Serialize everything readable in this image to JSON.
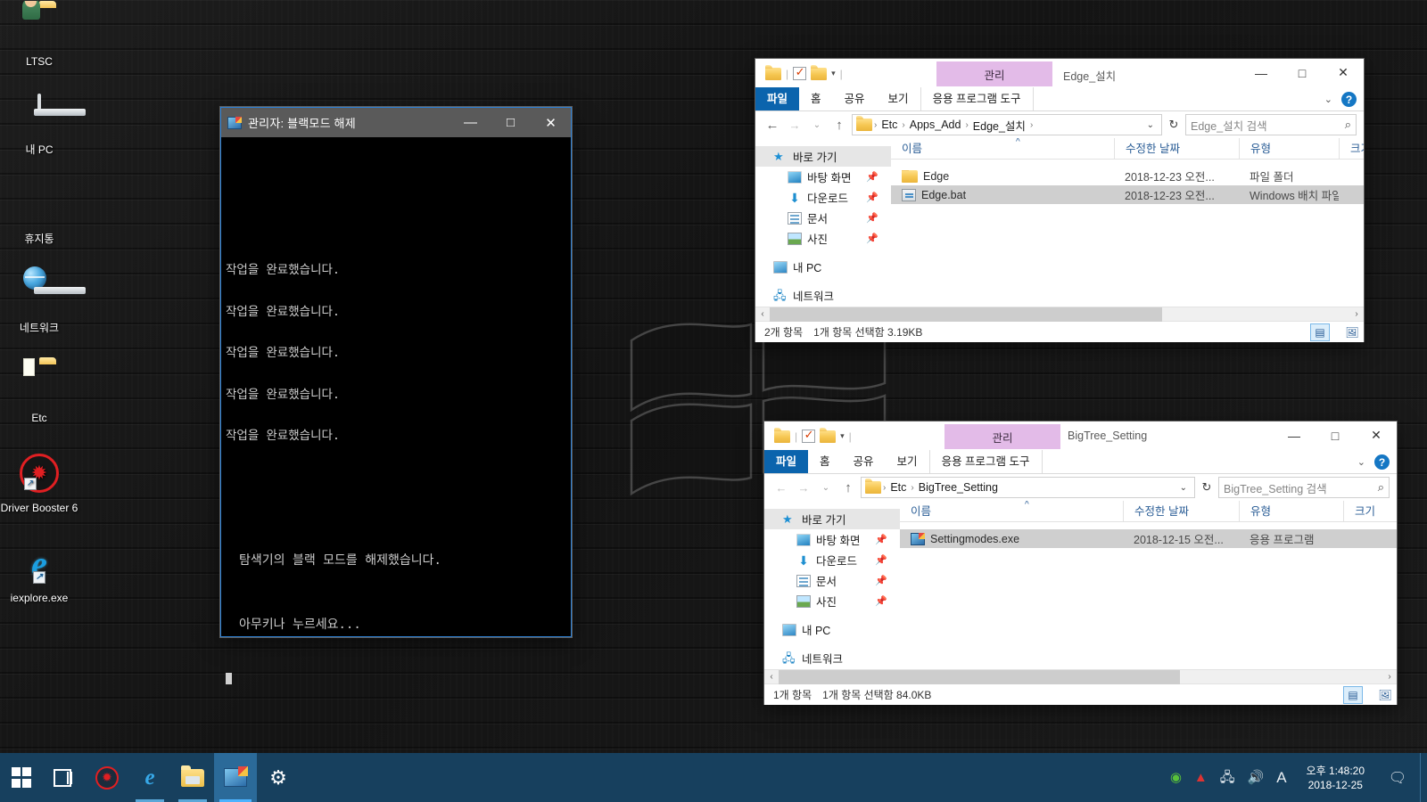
{
  "desktop": {
    "icons": [
      {
        "label": "LTSC",
        "icon": "user-folder-icon"
      },
      {
        "label": "내 PC",
        "icon": "computer-icon"
      },
      {
        "label": "휴지통",
        "icon": "recycle-bin-icon"
      },
      {
        "label": "네트워크",
        "icon": "network-icon"
      },
      {
        "label": "Etc",
        "icon": "folder-icon"
      },
      {
        "label": "Driver Booster 6",
        "icon": "driver-booster-icon"
      },
      {
        "label": "iexplore.exe",
        "icon": "internet-explorer-icon"
      }
    ]
  },
  "console": {
    "title": "관리자:  블랙모드 해제",
    "icon": "console-icon",
    "minimize": "—",
    "maximize": "□",
    "close": "✕",
    "lines": [
      "작업을 완료했습니다.",
      "작업을 완료했습니다.",
      "작업을 완료했습니다.",
      "작업을 완료했습니다.",
      "작업을 완료했습니다."
    ],
    "message": "탐색기의 블랙 모드를 해제했습니다.",
    "prompt": "아무키나 누르세요..."
  },
  "explorer1": {
    "window_title": "Edge_설치",
    "context_tab": "관리",
    "minimize": "—",
    "maximize": "□",
    "close": "✕",
    "ribbon_tabs": [
      "파일",
      "홈",
      "공유",
      "보기",
      "응용 프로그램 도구"
    ],
    "help_glyph": "?",
    "collapse_glyph": "⌄",
    "address": {
      "back": "←",
      "forward": "→",
      "recent": "⌄",
      "up": "↑",
      "crumbs": [
        "Etc",
        "Apps_Add",
        "Edge_설치"
      ],
      "trailing_arrow": "›",
      "dropdown": "⌄",
      "refresh": "↻"
    },
    "search_placeholder": "Edge_설치 검색",
    "nav": {
      "groups": [
        {
          "label": "바로 가기",
          "icon": "quick-access-star-icon",
          "selected": true,
          "children": [
            {
              "label": "바탕 화면",
              "icon": "desktop-icon",
              "pinned": true
            },
            {
              "label": "다운로드",
              "icon": "downloads-icon",
              "pinned": true
            },
            {
              "label": "문서",
              "icon": "documents-icon",
              "pinned": true
            },
            {
              "label": "사진",
              "icon": "pictures-icon",
              "pinned": true
            }
          ]
        },
        {
          "label": "내 PC",
          "icon": "this-pc-icon",
          "children": []
        },
        {
          "label": "네트워크",
          "icon": "network-icon",
          "children": []
        }
      ]
    },
    "columns": [
      "이름",
      "수정한 날짜",
      "유형",
      "크기"
    ],
    "sort_indicator": "^",
    "rows": [
      {
        "name": "Edge",
        "date": "2018-12-23 오전...",
        "type": "파일 폴더",
        "size": "",
        "icon": "folder-icon",
        "selected": false
      },
      {
        "name": "Edge.bat",
        "date": "2018-12-23 오전...",
        "type": "Windows 배치 파일",
        "size": "",
        "icon": "batch-file-icon",
        "selected": true
      }
    ],
    "status": {
      "count": "2개 항목",
      "selection": "1개 항목 선택함 3.19KB"
    },
    "view_details": "details-view-icon",
    "view_large": "large-icons-view-icon"
  },
  "explorer2": {
    "window_title": "BigTree_Setting",
    "context_tab": "관리",
    "minimize": "—",
    "maximize": "□",
    "close": "✕",
    "ribbon_tabs": [
      "파일",
      "홈",
      "공유",
      "보기",
      "응용 프로그램 도구"
    ],
    "help_glyph": "?",
    "collapse_glyph": "⌄",
    "address": {
      "back": "←",
      "forward": "→",
      "recent": "⌄",
      "up": "↑",
      "crumbs": [
        "Etc",
        "BigTree_Setting"
      ],
      "trailing_arrow": "",
      "dropdown": "⌄",
      "refresh": "↻"
    },
    "search_placeholder": "BigTree_Setting 검색",
    "nav": {
      "groups": [
        {
          "label": "바로 가기",
          "icon": "quick-access-star-icon",
          "selected": true,
          "children": [
            {
              "label": "바탕 화면",
              "icon": "desktop-icon",
              "pinned": true
            },
            {
              "label": "다운로드",
              "icon": "downloads-icon",
              "pinned": true
            },
            {
              "label": "문서",
              "icon": "documents-icon",
              "pinned": true
            },
            {
              "label": "사진",
              "icon": "pictures-icon",
              "pinned": true
            }
          ]
        },
        {
          "label": "내 PC",
          "icon": "this-pc-icon",
          "children": []
        },
        {
          "label": "네트워크",
          "icon": "network-icon",
          "children": []
        }
      ]
    },
    "columns": [
      "이름",
      "수정한 날짜",
      "유형",
      "크기"
    ],
    "sort_indicator": "^",
    "rows": [
      {
        "name": "Settingmodes.exe",
        "date": "2018-12-15 오전...",
        "type": "응용 프로그램",
        "size": "",
        "icon": "exe-file-icon",
        "selected": true
      }
    ],
    "status": {
      "count": "1개 항목",
      "selection": "1개 항목 선택함 84.0KB"
    },
    "view_details": "details-view-icon",
    "view_large": "large-icons-view-icon"
  },
  "taskbar": {
    "buttons": [
      {
        "name": "start-button",
        "icon": "windows-logo-icon"
      },
      {
        "name": "task-view-button",
        "icon": "task-view-icon"
      },
      {
        "name": "driver-booster-button",
        "icon": "driver-booster-icon"
      },
      {
        "name": "internet-explorer-button",
        "icon": "internet-explorer-icon"
      },
      {
        "name": "file-explorer-button",
        "icon": "folder-icon"
      },
      {
        "name": "cmd-button",
        "icon": "console-icon"
      },
      {
        "name": "settings-button",
        "icon": "gear-icon"
      }
    ],
    "tray": [
      {
        "name": "nvidia-icon",
        "glyph": "◉"
      },
      {
        "name": "triangle-icon",
        "glyph": "▲"
      },
      {
        "name": "network-tray-icon",
        "glyph": "🖧"
      },
      {
        "name": "volume-icon",
        "glyph": "🔊"
      },
      {
        "name": "ime-icon",
        "glyph": "A"
      }
    ],
    "clock": {
      "time": "오후 1:48:20",
      "date": "2018-12-25"
    },
    "notifications": "💬",
    "colors": {
      "taskbar_bg": "#17405e",
      "active_btn": "#2b6a99",
      "accent": "#4cb3ff"
    }
  }
}
